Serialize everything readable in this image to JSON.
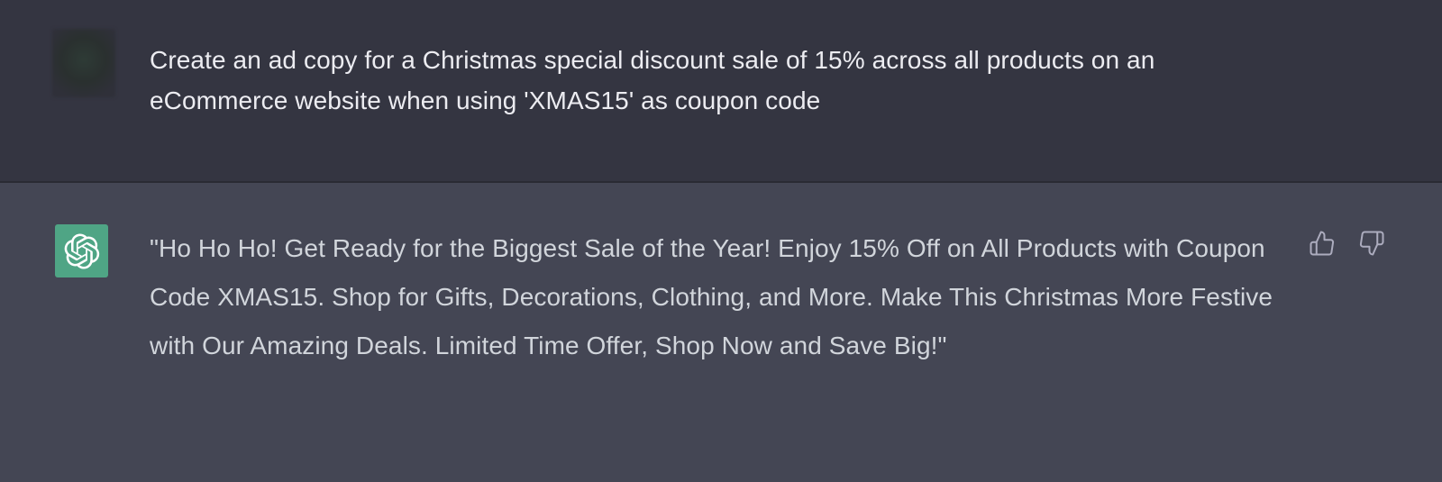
{
  "conversation": {
    "user_message": {
      "text": "Create an ad copy for a Christmas special discount sale of 15% across all products on an eCommerce website when using 'XMAS15' as coupon code"
    },
    "assistant_message": {
      "text": "\"Ho Ho Ho! Get Ready for the Biggest Sale of the Year! Enjoy 15% Off on All Products with Coupon Code XMAS15. Shop for Gifts, Decorations, Clothing, and More. Make This Christmas More Festive with Our Amazing Deals. Limited Time Offer, Shop Now and Save Big!\""
    },
    "icons": {
      "user_avatar": "blurred-user-avatar",
      "assistant_avatar": "openai-logo-icon",
      "like": "thumbs-up-icon",
      "dislike": "thumbs-down-icon"
    }
  },
  "colors": {
    "user_row_bg": "#343541",
    "assistant_row_bg": "#444654",
    "assistant_avatar_bg": "#4fa585",
    "user_text": "#ececf1",
    "assistant_text": "#d1d5db",
    "icon": "#acacbe"
  }
}
